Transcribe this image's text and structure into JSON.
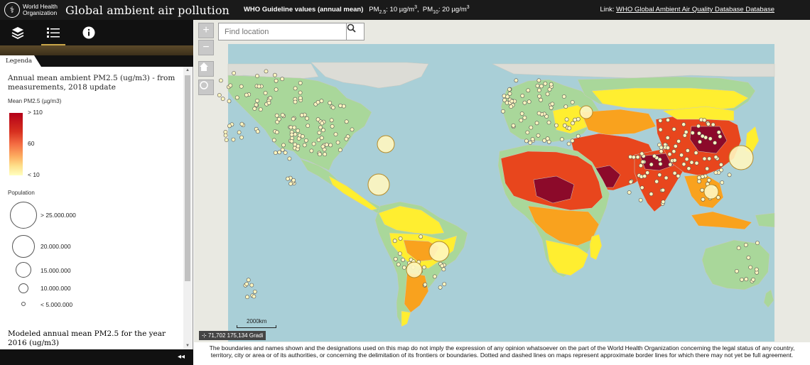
{
  "header": {
    "org_name": "World Health\nOrganization",
    "title": "Global ambient air pollution",
    "guideline_label": "WHO Guideline values (annual mean)",
    "pm25_prefix": "PM",
    "pm25_sub": "2.5",
    "pm25_value": ": 10 µg/m",
    "pm25_unit_sup": "3",
    "pm10_prefix": "PM",
    "pm10_sub": "10",
    "pm10_value": ": 20 µg/m",
    "pm10_unit_sup": "3",
    "link_label": "Link:",
    "link_text": "WHO Global Ambient Air Quality Database Database"
  },
  "toolbar": {
    "items": [
      {
        "name": "layers-icon"
      },
      {
        "name": "legend-icon"
      },
      {
        "name": "info-icon"
      }
    ]
  },
  "panel": {
    "tab_label": "Legenda",
    "legend_title": "Annual mean ambient PM2.5 (ug/m3) - from measurements, 2018 update",
    "mean_label": "Mean PM2.5 (µg/m3)",
    "ramp_max": "> 110",
    "ramp_mid": "60",
    "ramp_min": "< 10",
    "population_label": "Population",
    "population_classes": [
      "> 25.000.000",
      "20.000.000",
      "15.000.000",
      "10.000.000",
      "< 5.000.000"
    ],
    "legend_title_2": "Modeled annual mean PM2.5 for the year 2016 (ug/m3)"
  },
  "map": {
    "search_placeholder": "Find location",
    "zoom_in": "+",
    "zoom_out": "−",
    "scale_label": "2000km",
    "coords_text": "71,702 175,134 Gradi",
    "colors": {
      "ocean": "#a9cfd7",
      "land_clean": "#a9d79a",
      "land_gray": "#dcdcd6",
      "pm_low": "#ffee30",
      "pm_med": "#f9a21e",
      "pm_high": "#e8461d",
      "pm_vhigh": "#c1141c",
      "pm_extreme": "#8c0a2a",
      "station": "#fff6c0"
    }
  },
  "disclaimer": "The boundaries and names shown and the designations used on this map do not imply the expression of any opinion whatsoever on the part of the World Health Organization concerning the legal status of any country, territory, city or area or of its authorities, or concerning the delimitation of its frontiers or boundaries. Dotted and dashed lines on maps represent approximate border lines for which there may not yet be full agreement."
}
